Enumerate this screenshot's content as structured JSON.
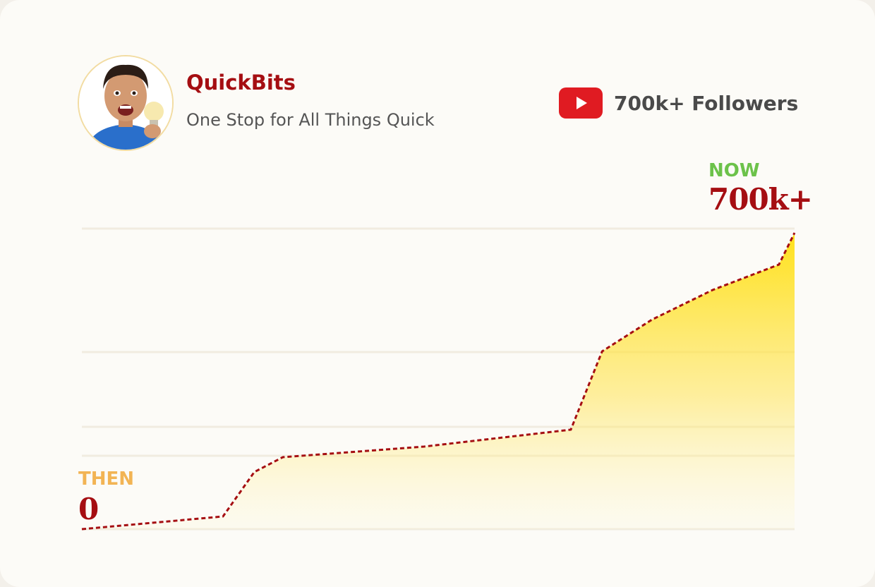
{
  "channel": {
    "name": "QuickBits",
    "tagline": "One Stop for All Things Quick"
  },
  "platform": {
    "icon": "youtube-icon",
    "followers_label": "700k+ Followers"
  },
  "markers": {
    "now_label": "NOW",
    "now_value": "700k+",
    "then_label": "THEN",
    "then_value": "0"
  },
  "colors": {
    "brand_red": "#a50e12",
    "now_green": "#6cc24a",
    "then_orange": "#f2b454",
    "area_fill": "#ffe11a",
    "youtube_red": "#e01b22"
  },
  "chart_data": {
    "type": "area",
    "title": "",
    "xlabel": "",
    "ylabel": "",
    "x": [
      0,
      1,
      2,
      3,
      4,
      5,
      6,
      7,
      8,
      9,
      10,
      11
    ],
    "series": [
      {
        "values": [
          0,
          30,
          135,
          170,
          195,
          235,
          420,
          495,
          565,
          625,
          700
        ]
      }
    ],
    "ylim": [
      0,
      700
    ],
    "gridlines": [
      0,
      175,
      245,
      420,
      700
    ],
    "grid": true,
    "line_style": "dashed",
    "start_label": "0",
    "end_label": "700k+"
  }
}
